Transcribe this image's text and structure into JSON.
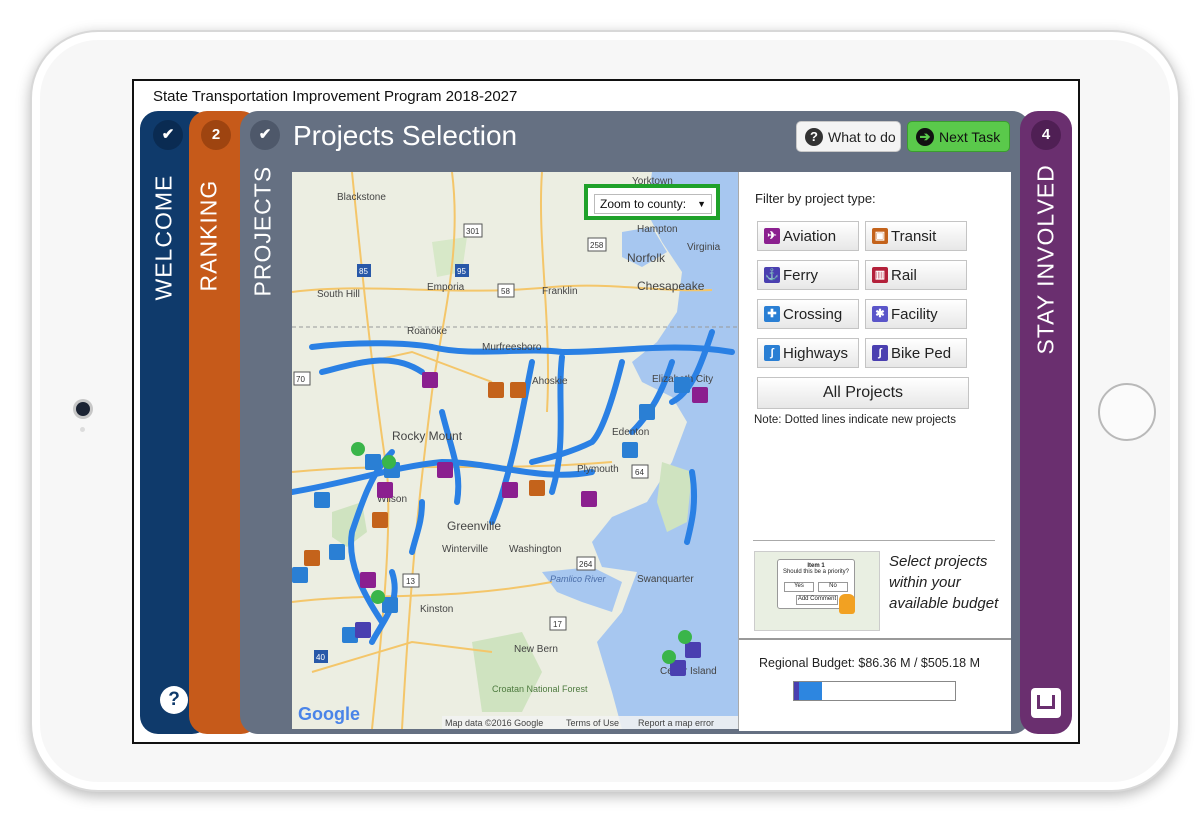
{
  "app_title": "State Transportation Improvement Program 2018-2027",
  "tabs": {
    "welcome": {
      "label": "WELCOME",
      "badge": "✔"
    },
    "ranking": {
      "label": "RANKING",
      "badge": "2"
    },
    "projects": {
      "label": "PROJECTS",
      "badge": "✔"
    },
    "stay_involved": {
      "label": "STAY INVOLVED",
      "badge": "4"
    }
  },
  "help_symbol": "?",
  "page_title": "Projects Selection",
  "toolbar": {
    "what_to_do": "What to do",
    "what_icon": "?",
    "next_task": "Next Task",
    "next_icon": "➔"
  },
  "map": {
    "zoom_select": "Zoom to county:",
    "google_logo": "Google",
    "attribution": "Map data ©2016 Google",
    "terms": "Terms of Use",
    "report": "Report a map error",
    "places": [
      {
        "name": "Yorktown"
      },
      {
        "name": "Blackstone"
      },
      {
        "name": "Hampton"
      },
      {
        "name": "Virginia"
      },
      {
        "name": "Norfolk"
      },
      {
        "name": "Chesapeake"
      },
      {
        "name": "South Hill"
      },
      {
        "name": "Emporia"
      },
      {
        "name": "Franklin"
      },
      {
        "name": "Roanoke"
      },
      {
        "name": "Murfreesboro"
      },
      {
        "name": "Ahoskie"
      },
      {
        "name": "Elizabeth City"
      },
      {
        "name": "Edenton"
      },
      {
        "name": "Plymouth"
      },
      {
        "name": "Rocky Mount"
      },
      {
        "name": "Wilson"
      },
      {
        "name": "Greenville"
      },
      {
        "name": "Winterville"
      },
      {
        "name": "Washington"
      },
      {
        "name": "Swanquarter"
      },
      {
        "name": "Kinston"
      },
      {
        "name": "New Bern"
      },
      {
        "name": "Cedar Island"
      },
      {
        "name": "Croatan National Forest"
      },
      {
        "name": "Pamlico River"
      }
    ],
    "route_shields": [
      "301",
      "85",
      "95",
      "58",
      "258",
      "64",
      "264",
      "13",
      "40",
      "70",
      "17"
    ]
  },
  "filter": {
    "title": "Filter by project type:",
    "buttons": [
      {
        "label": "Aviation",
        "icon": "plane-icon",
        "color": "#8b1f8f",
        "glyph": "✈"
      },
      {
        "label": "Transit",
        "icon": "bus-icon",
        "color": "#c4631b",
        "glyph": "▣"
      },
      {
        "label": "Ferry",
        "icon": "anchor-icon",
        "color": "#4a3fb0",
        "glyph": "⚓"
      },
      {
        "label": "Rail",
        "icon": "rail-icon",
        "color": "#b3203a",
        "glyph": "▥"
      },
      {
        "label": "Crossing",
        "icon": "crossing-icon",
        "color": "#2a7fd4",
        "glyph": "✚"
      },
      {
        "label": "Facility",
        "icon": "facility-icon",
        "color": "#5a55c9",
        "glyph": "✱"
      },
      {
        "label": "Highways",
        "icon": "highway-icon",
        "color": "#2a7fd4",
        "glyph": "∫"
      },
      {
        "label": "Bike Ped",
        "icon": "bike-icon",
        "color": "#4a3fb0",
        "glyph": "∫"
      }
    ],
    "all_label": "All Projects",
    "note": "Note: Dotted lines indicate new projects"
  },
  "tutorial": {
    "text": "Select projects within your available budget",
    "popup_title": "Item 1",
    "popup_question": "Should this be a priority?",
    "popup_yes": "Yes",
    "popup_no": "No",
    "popup_comment": "Add Comment"
  },
  "budget": {
    "label": "Regional Budget: $86.36 M / $505.18 M",
    "fraction": 0.171
  },
  "colors": {
    "welcome": "#0f3a6b",
    "ranking": "#c65a1a",
    "projects": "#657082",
    "stay": "#6a2f6f",
    "next_task": "#5ac94b",
    "route": "#2a80e4"
  }
}
